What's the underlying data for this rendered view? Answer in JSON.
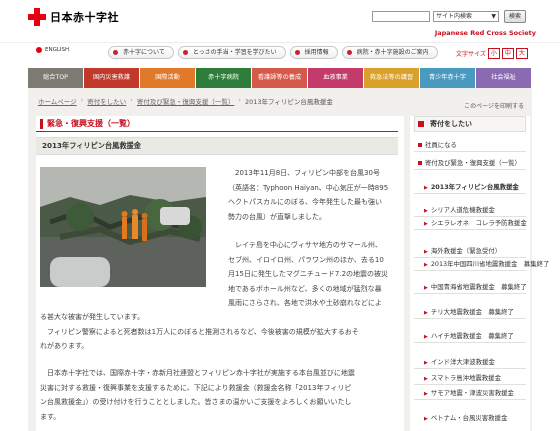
{
  "header": {
    "logo_text": "日本赤十字社",
    "search_scope": "サイト内検索",
    "search_button": "検索",
    "org_en": "Japanese Red Cross Society"
  },
  "subhead": {
    "lang": "ENGLISH",
    "nav": [
      "赤十字について",
      "とっさの手当・学習を学びたい",
      "採用情報",
      "病院・赤十字施設のご案内"
    ],
    "fontsize_label": "文字サイズ",
    "fontsize_options": [
      "小",
      "中",
      "大"
    ]
  },
  "mainnav": {
    "items": [
      {
        "label": "総合TOP",
        "color": "#7d7a73"
      },
      {
        "label": "国内災害救護",
        "color": "#c0392b"
      },
      {
        "label": "国際活動",
        "color": "#e07a2a"
      },
      {
        "label": "赤十字病院",
        "color": "#2f7d3a"
      },
      {
        "label": "看護師等の養成",
        "color": "#d65a4a"
      },
      {
        "label": "血液事業",
        "color": "#c43a6a"
      },
      {
        "label": "救急法等の講習",
        "color": "#d9a12a"
      },
      {
        "label": "青少年赤十字",
        "color": "#4a9ac0"
      },
      {
        "label": "社会福祉",
        "color": "#8a6ab0"
      }
    ]
  },
  "breadcrumb": [
    "ホームページ",
    "寄付をしたい",
    "寄付及び緊急・復興支援（一覧）",
    "2013年フィリピン台風救援金"
  ],
  "print_label": "このページを印刷する",
  "section_title": "緊急・復興支援（一覧）",
  "article_title": "2013年フィリピン台風救援金",
  "paragraphs": [
    "2013年11月8日、フィリピン中部を台風30号",
    "（英語名：Typhoon Haiyan、中心気圧が一時895",
    "ヘクトパスカルにのぼる、今年発生した最も強い",
    "勢力の台風）が直撃しました。",
    "レイテ島を中心にヴィサヤ地方のサマール州、",
    "セブ州、イロイロ州、パラワン州のほか、去る10",
    "月15日に発生したマグニチュード7.2の地震の被災",
    "地であるボホール州など、多くの地域が猛烈な暴",
    "風雨にさらされ、各地で洪水や土砂崩れなどによ",
    "る甚大な被害が発生しています。",
    "フィリピン警察によると死者数は1万人にのぼると推測されるなど、今後被害の規模が拡大するおそ",
    "れがあります。",
    "日本赤十字社では、国際赤十字・赤新月社連盟とフィリピン赤十字社が実施する本台風並びに地震",
    "災害に対する救援・復興事業を支援するために、下記により救援金（救援金名称「2013年フィリピ",
    "ン台風救援金」）の受け付けを行うこととしました。皆さまの温かいご支援をよろしくお願いいたし",
    "ます。"
  ],
  "sidebar": {
    "head": "寄付をしたい",
    "items": [
      {
        "label": "社員になる",
        "type": "b"
      },
      {
        "label": "寄付及び緊急・復興支援（一覧）",
        "type": "b"
      },
      {
        "label": "2013年フィリピン台風救援金",
        "type": "tri",
        "active": true
      },
      {
        "label": "シリア人道危機救援金",
        "type": "tri"
      },
      {
        "label": "シエラレオネ　コレラ予防救援金",
        "type": "tri"
      },
      {
        "label": "海外救援金（緊急受付）",
        "type": "tri"
      },
      {
        "label": "2013年中国四川省地震救援金　募集終了",
        "type": "tri"
      },
      {
        "label": "中国青海省地震救援金　募集終了",
        "type": "tri"
      },
      {
        "label": "チリ大地震救援金　募集終了",
        "type": "tri"
      },
      {
        "label": "ハイチ地震救援金　募集終了",
        "type": "tri"
      },
      {
        "label": "インド洋大津波救援金",
        "type": "tri"
      },
      {
        "label": "スマトラ島沖地震救援金",
        "type": "tri"
      },
      {
        "label": "サモア地震・津波災害救援金",
        "type": "tri"
      },
      {
        "label": "ベトナム・台風災害救援金",
        "type": "tri"
      }
    ]
  }
}
